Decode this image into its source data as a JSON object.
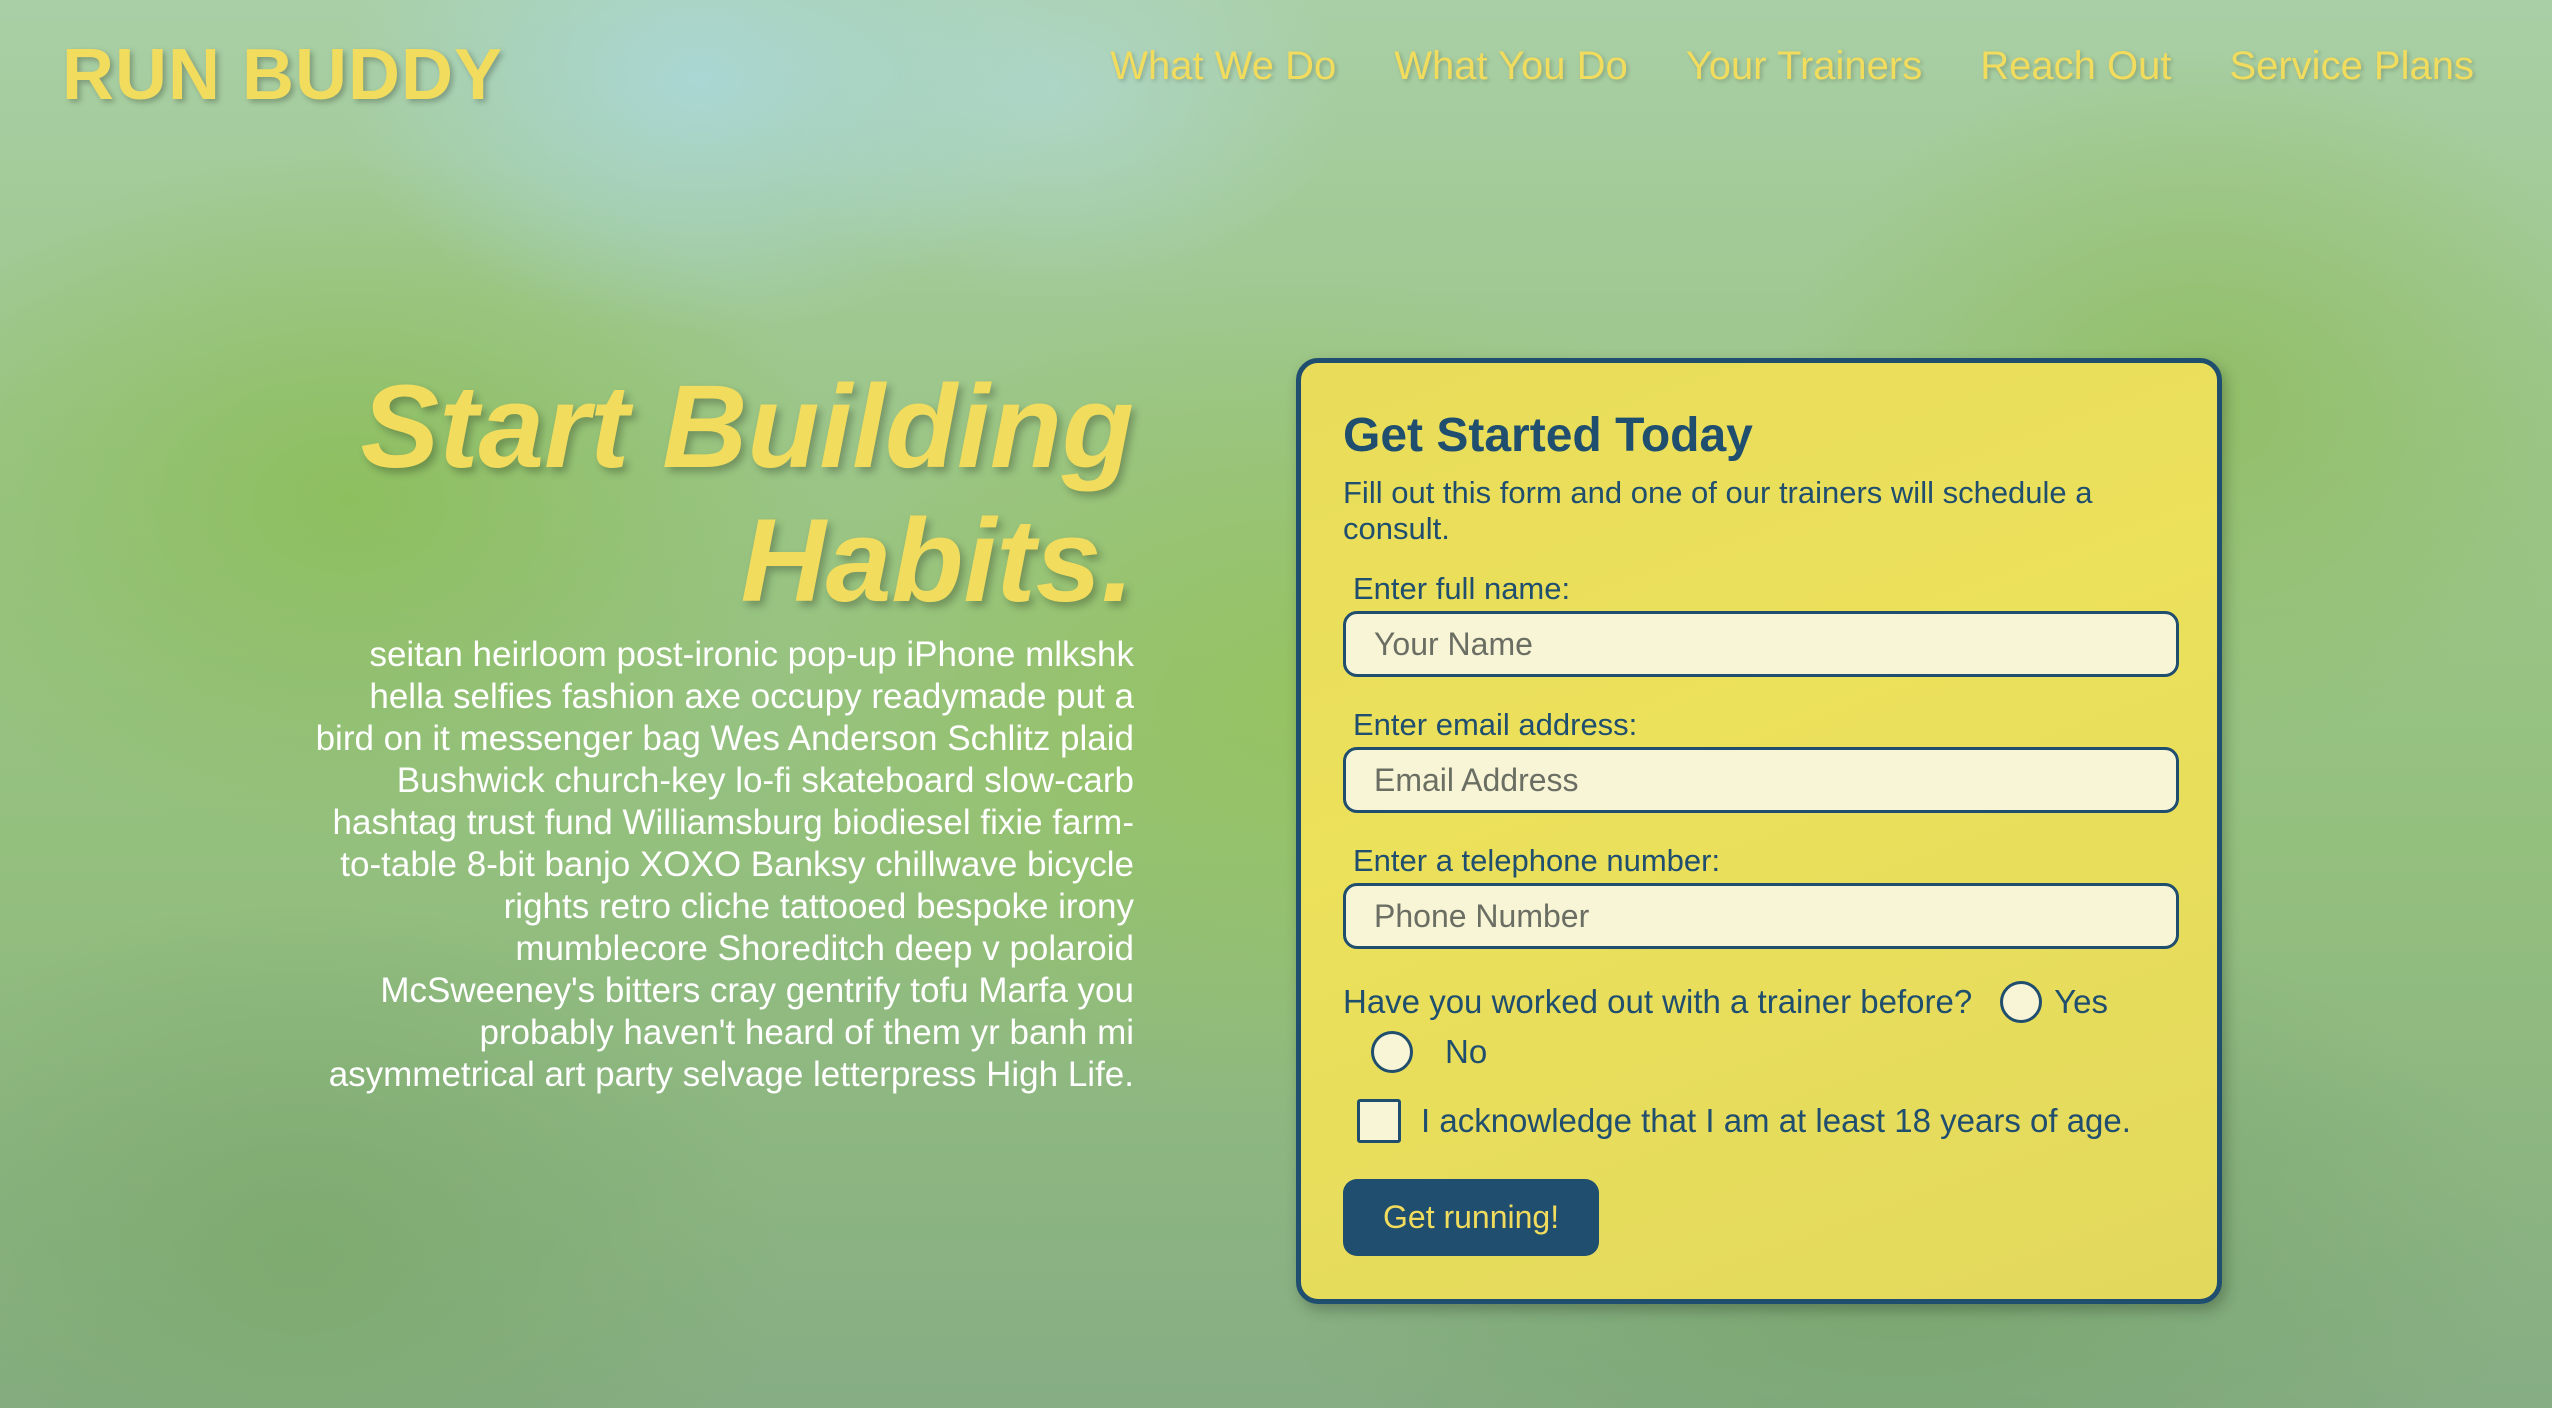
{
  "header": {
    "brand": "RUN BUDDY",
    "nav": [
      "What We Do",
      "What You Do",
      "Your Trainers",
      "Reach Out",
      "Service Plans"
    ]
  },
  "hero": {
    "heading_line1": "Start Building",
    "heading_line2": "Habits.",
    "body": "seitan heirloom post-ironic pop-up iPhone mlkshk hella selfies fashion axe occupy readymade put a bird on it messenger bag Wes Anderson Schlitz plaid Bushwick church-key lo-fi skateboard slow-carb hashtag trust fund Williamsburg biodiesel fixie farm-to-table 8-bit banjo XOXO Banksy chillwave bicycle rights retro cliche tattooed bespoke irony mumblecore Shoreditch deep v polaroid McSweeney's bitters cray gentrify tofu Marfa you probably haven't heard of them yr banh mi asymmetrical art party selvage letterpress High Life."
  },
  "form": {
    "title": "Get Started Today",
    "intro": "Fill out this form and one of our trainers will schedule a consult.",
    "name_label": "Enter full name:",
    "name_placeholder": "Your Name",
    "email_label": "Enter email address:",
    "email_placeholder": "Email Address",
    "phone_label": "Enter a telephone number:",
    "phone_placeholder": "Phone Number",
    "trainer_question": "Have you worked out with a trainer before?",
    "yes_label": "Yes",
    "no_label": "No",
    "age_ack": "I acknowledge that I am at least 18 years of age.",
    "submit_label": "Get running!"
  },
  "colors": {
    "accent_yellow": "#f2dc5d",
    "navy": "#1f4e6e",
    "card_bg": "#e8dc5a"
  }
}
